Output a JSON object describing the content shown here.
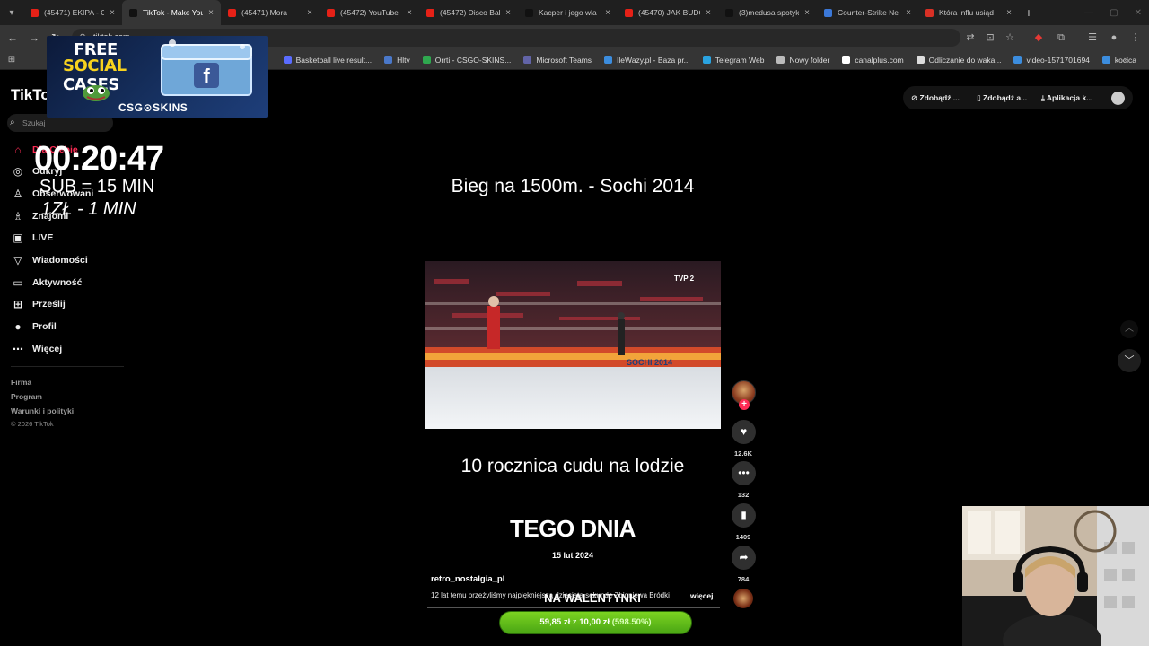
{
  "browser": {
    "tabs": [
      {
        "title": "(45471) EKIPA - O",
        "fav": "#e62117",
        "active": false
      },
      {
        "title": "TikTok - Make You",
        "fav": "#111111",
        "active": true
      },
      {
        "title": "(45471) Mora",
        "fav": "#e62117",
        "active": false
      },
      {
        "title": "(45472) YouTube",
        "fav": "#e62117",
        "active": false
      },
      {
        "title": "(45472) Disco Bal",
        "fav": "#e62117",
        "active": false
      },
      {
        "title": "Kacper i jego wła",
        "fav": "#111111",
        "active": false
      },
      {
        "title": "(45470) JAK BUDO",
        "fav": "#e62117",
        "active": false
      },
      {
        "title": "(3)medusa spotyk",
        "fav": "#111111",
        "active": false
      },
      {
        "title": "Counter-Strike Ne",
        "fav": "#3b78d8",
        "active": false
      },
      {
        "title": "Która influ usiąd",
        "fav": "#d93025",
        "active": false
      }
    ],
    "tab_close_glyph": "×",
    "new_tab_glyph": "+",
    "url": "tiktok.com",
    "bookmarks": [
      {
        "label": "Basketball live result...",
        "fav": "#5a6cff"
      },
      {
        "label": "Hltv",
        "fav": "#4a78c9"
      },
      {
        "label": "Orrti - CSGO-SKINS...",
        "fav": "#2fa84f"
      },
      {
        "label": "Microsoft Teams",
        "fav": "#6264a7"
      },
      {
        "label": "IleWazy.pl - Baza pr...",
        "fav": "#3c8dde"
      },
      {
        "label": "Telegram Web",
        "fav": "#2aa3e0"
      },
      {
        "label": "Nowy folder",
        "fav": "#bbbbbb"
      },
      {
        "label": "canalplus.com",
        "fav": "#ffffff"
      },
      {
        "label": "Odliczanie do waka...",
        "fav": "#dddddd"
      },
      {
        "label": "video-1571701694",
        "fav": "#3c8dde"
      },
      {
        "label": "kocica",
        "fav": "#3c8dde"
      }
    ]
  },
  "sidebar": {
    "logo": "TikTok",
    "search_placeholder": "Szukaj",
    "items": [
      {
        "label": "Dla Ciebie",
        "icon": "home-icon",
        "glyph": "⌂"
      },
      {
        "label": "Odkryj",
        "icon": "compass-icon",
        "glyph": "◎"
      },
      {
        "label": "Obserwowani",
        "icon": "user-icon",
        "glyph": "♙"
      },
      {
        "label": "Znajomi",
        "icon": "friends-icon",
        "glyph": "♗"
      },
      {
        "label": "LIVE",
        "icon": "live-icon",
        "glyph": "▣"
      },
      {
        "label": "Wiadomości",
        "icon": "send-icon",
        "glyph": "▽"
      },
      {
        "label": "Aktywność",
        "icon": "inbox-icon",
        "glyph": "▭"
      },
      {
        "label": "Prześlij",
        "icon": "upload-icon",
        "glyph": "⊞"
      },
      {
        "label": "Profil",
        "icon": "profile-icon",
        "glyph": "●"
      },
      {
        "label": "Więcej",
        "icon": "more-icon",
        "glyph": "⋯"
      }
    ],
    "footer": [
      "Firma",
      "Program",
      "Warunki i polityki"
    ],
    "copyright": "© 2026 TikTok"
  },
  "header": {
    "items": [
      "Zdobądź ...",
      "Zdobądź a...",
      "Aplikacja k..."
    ]
  },
  "overlay": {
    "promo_free": "FREE",
    "promo_social": "SOCIAL",
    "promo_cases": "CASES",
    "promo_brand": "CSG⊙SKINS",
    "timer": "00:20:47",
    "sub_rule": "SUB = 15 MIN",
    "zl_rule": "1ZŁ - 1 MIN"
  },
  "video": {
    "title": "Bieg na 1500m. - Sochi 2014",
    "subtitle": "10 rocznica cudu na lodzie",
    "tego": "TEGO DNIA",
    "date": "15 lut 2024",
    "nawal": "NA WALENTYNKI",
    "author": "retro_nostalgia_pl",
    "description": "12 lat temu przeżyliśmy najpiękniejszą dziesiątą sekundę Zbigniewa Bródki",
    "more": "więcej",
    "broadcaster": "TVP 2",
    "rink_text": "SOCHI 2014"
  },
  "actions": {
    "likes": "12.6K",
    "comments": "132",
    "saves": "1409",
    "shares": "784"
  },
  "goal": {
    "current": "59,85 zł",
    "of": "z",
    "target": "10,00 zł",
    "percent": "(598.50%)"
  }
}
